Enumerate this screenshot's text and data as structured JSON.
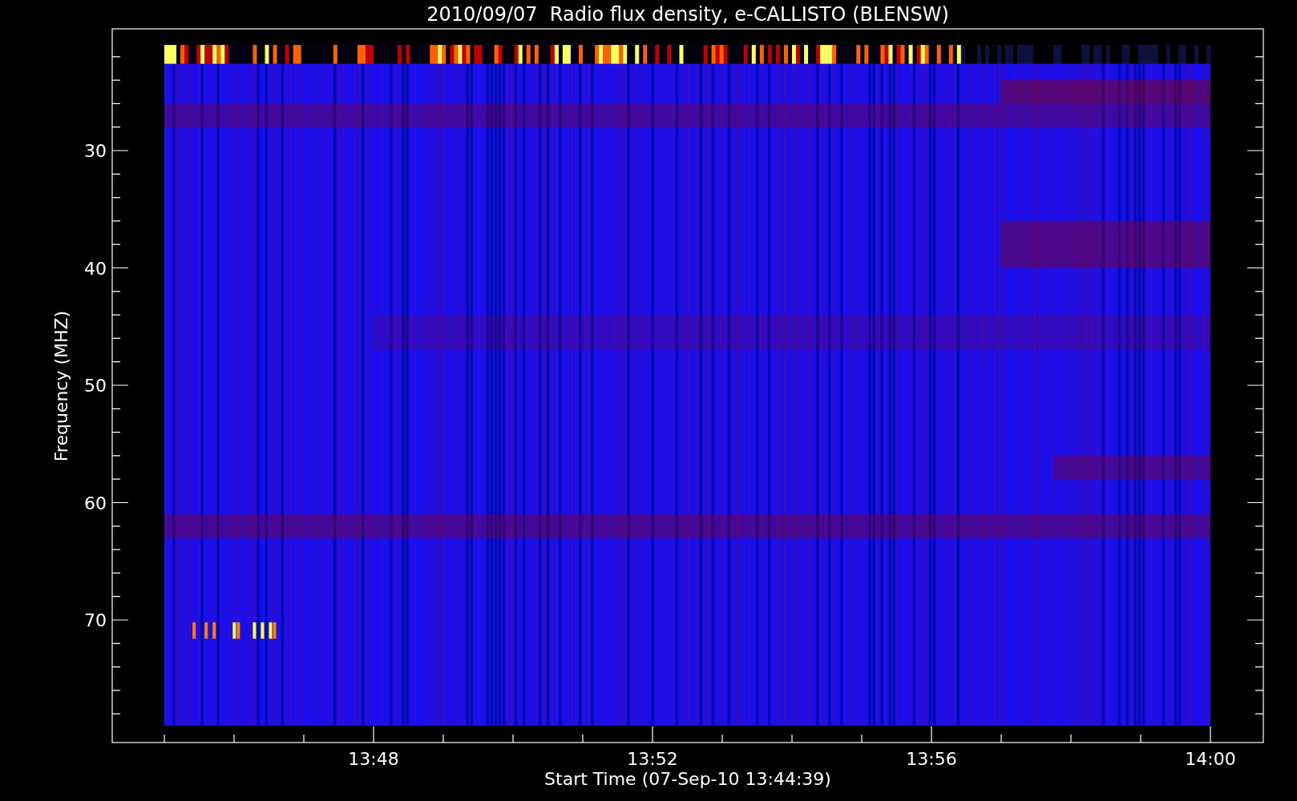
{
  "title": "2010/09/07  Radio flux density, e-CALLISTO (BLENSW)",
  "xlabel": "Start Time (07-Sep-10 13:44:39)",
  "ylabel": "Frequency (MHZ)",
  "xticks": [
    "13:48",
    "13:52",
    "13:56",
    "14:00"
  ],
  "yticks": [
    "30",
    "40",
    "50",
    "60",
    "70"
  ]
}
